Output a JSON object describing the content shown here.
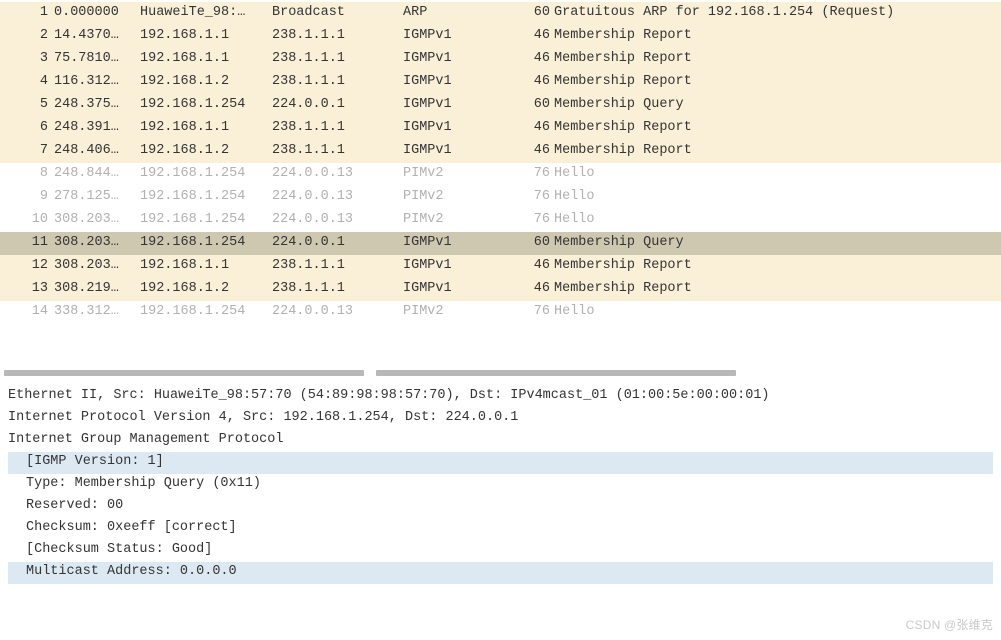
{
  "packets": [
    {
      "no": "1",
      "time": "0.000000",
      "src": "HuaweiTe_98:…",
      "dst": "Broadcast",
      "proto": "ARP",
      "len": "60",
      "info": "Gratuitous ARP for 192.168.1.254 (Request)",
      "style": "beige"
    },
    {
      "no": "2",
      "time": "14.4370…",
      "src": "192.168.1.1",
      "dst": "238.1.1.1",
      "proto": "IGMPv1",
      "len": "46",
      "info": "Membership Report",
      "style": "beige"
    },
    {
      "no": "3",
      "time": "75.7810…",
      "src": "192.168.1.1",
      "dst": "238.1.1.1",
      "proto": "IGMPv1",
      "len": "46",
      "info": "Membership Report",
      "style": "beige"
    },
    {
      "no": "4",
      "time": "116.312…",
      "src": "192.168.1.2",
      "dst": "238.1.1.1",
      "proto": "IGMPv1",
      "len": "46",
      "info": "Membership Report",
      "style": "beige"
    },
    {
      "no": "5",
      "time": "248.375…",
      "src": "192.168.1.254",
      "dst": "224.0.0.1",
      "proto": "IGMPv1",
      "len": "60",
      "info": "Membership Query",
      "style": "beige"
    },
    {
      "no": "6",
      "time": "248.391…",
      "src": "192.168.1.1",
      "dst": "238.1.1.1",
      "proto": "IGMPv1",
      "len": "46",
      "info": "Membership Report",
      "style": "beige"
    },
    {
      "no": "7",
      "time": "248.406…",
      "src": "192.168.1.2",
      "dst": "238.1.1.1",
      "proto": "IGMPv1",
      "len": "46",
      "info": "Membership Report",
      "style": "beige"
    },
    {
      "no": "8",
      "time": "248.844…",
      "src": "192.168.1.254",
      "dst": "224.0.0.13",
      "proto": "PIMv2",
      "len": "76",
      "info": "Hello",
      "style": "muted"
    },
    {
      "no": "9",
      "time": "278.125…",
      "src": "192.168.1.254",
      "dst": "224.0.0.13",
      "proto": "PIMv2",
      "len": "76",
      "info": "Hello",
      "style": "muted"
    },
    {
      "no": "10",
      "time": "308.203…",
      "src": "192.168.1.254",
      "dst": "224.0.0.13",
      "proto": "PIMv2",
      "len": "76",
      "info": "Hello",
      "style": "muted"
    },
    {
      "no": "11",
      "time": "308.203…",
      "src": "192.168.1.254",
      "dst": "224.0.0.1",
      "proto": "IGMPv1",
      "len": "60",
      "info": "Membership Query",
      "style": "selected"
    },
    {
      "no": "12",
      "time": "308.203…",
      "src": "192.168.1.1",
      "dst": "238.1.1.1",
      "proto": "IGMPv1",
      "len": "46",
      "info": "Membership Report",
      "style": "beige"
    },
    {
      "no": "13",
      "time": "308.219…",
      "src": "192.168.1.2",
      "dst": "238.1.1.1",
      "proto": "IGMPv1",
      "len": "46",
      "info": "Membership Report",
      "style": "beige"
    },
    {
      "no": "14",
      "time": "338.312…",
      "src": "192.168.1.254",
      "dst": "224.0.0.13",
      "proto": "PIMv2",
      "len": "76",
      "info": "Hello",
      "style": "muted"
    }
  ],
  "details": {
    "eth": "Ethernet II, Src: HuaweiTe_98:57:70 (54:89:98:98:57:70), Dst: IPv4mcast_01 (01:00:5e:00:00:01)",
    "ip": "Internet Protocol Version 4, Src: 192.168.1.254, Dst: 224.0.0.1",
    "igmp_head": "Internet Group Management Protocol",
    "igmp_version": "[IGMP Version: 1]",
    "igmp_type": "Type: Membership Query (0x11)",
    "igmp_reserved": "Reserved: 00",
    "igmp_checksum": "Checksum: 0xeeff [correct]",
    "igmp_checksum_status": "[Checksum Status: Good]",
    "igmp_multicast": "Multicast Address: 0.0.0.0"
  },
  "watermark": "CSDN @张维克"
}
